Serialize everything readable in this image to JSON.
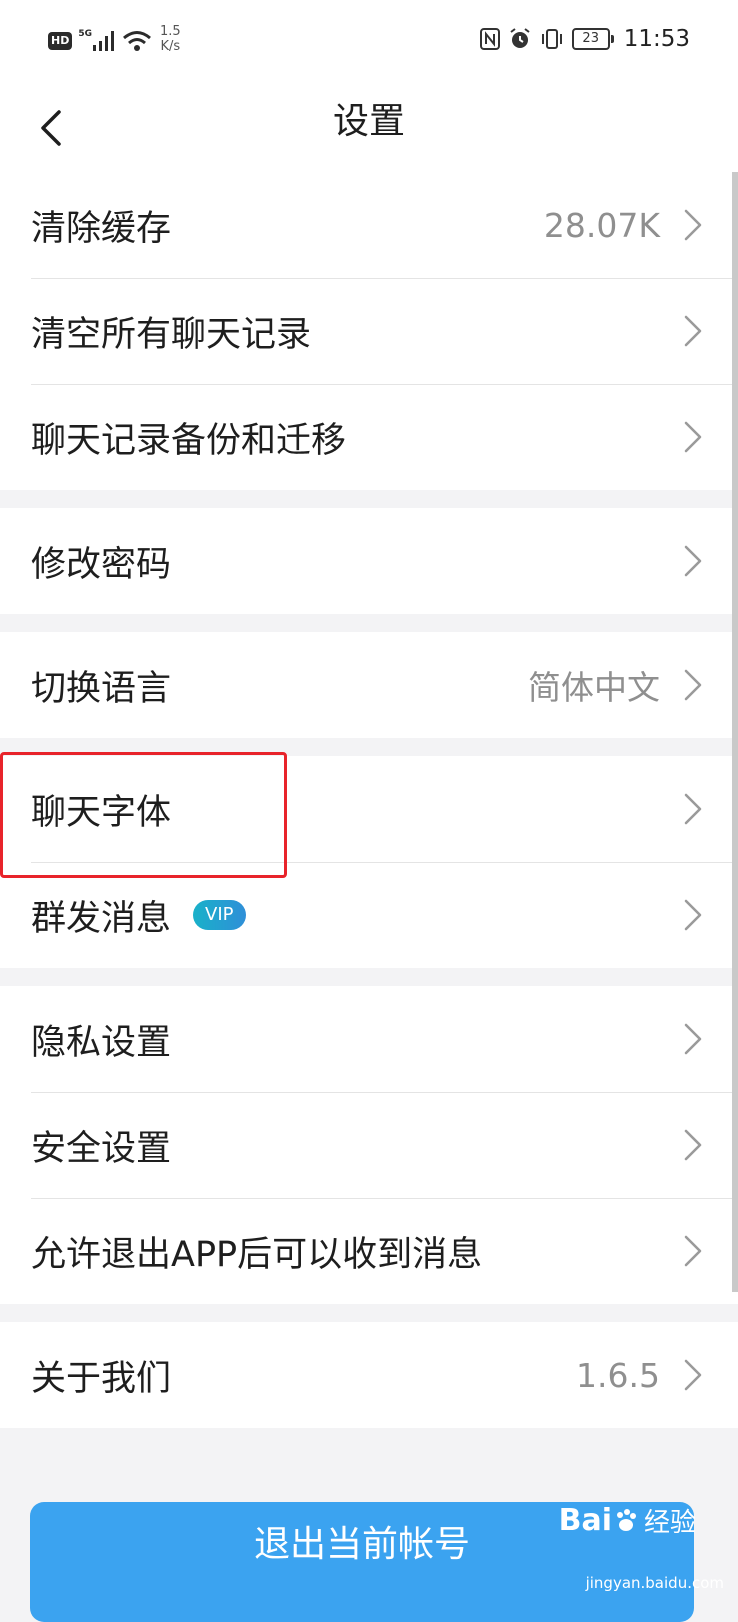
{
  "status_bar": {
    "hd": "HD",
    "network_type": "5G",
    "net_speed": "1.5\nK/s",
    "battery": "23",
    "time": "11:53"
  },
  "nav": {
    "title": "设置",
    "back_icon": "chevron-left-icon"
  },
  "groups": [
    [
      {
        "label": "清除缓存",
        "value": "28.07K"
      },
      {
        "label": "清空所有聊天记录"
      },
      {
        "label": "聊天记录备份和迁移"
      }
    ],
    [
      {
        "label": "修改密码"
      }
    ],
    [
      {
        "label": "切换语言",
        "value": "简体中文"
      }
    ],
    [
      {
        "label": "聊天字体"
      },
      {
        "label": "群发消息",
        "badge": "VIP"
      }
    ],
    [
      {
        "label": "隐私设置"
      },
      {
        "label": "安全设置"
      },
      {
        "label": "允许退出APP后可以收到消息"
      }
    ],
    [
      {
        "label": "关于我们",
        "value": "1.6.5"
      }
    ]
  ],
  "logout_button": "退出当前帐号",
  "watermark": {
    "logo": "Bai",
    "text": "经验",
    "domain": "jingyan.baidu.com"
  },
  "colors": {
    "accent": "#3ba3f0",
    "highlight": "#e8232a",
    "vip_start": "#19b1c9",
    "vip_end": "#2f8fd8"
  }
}
